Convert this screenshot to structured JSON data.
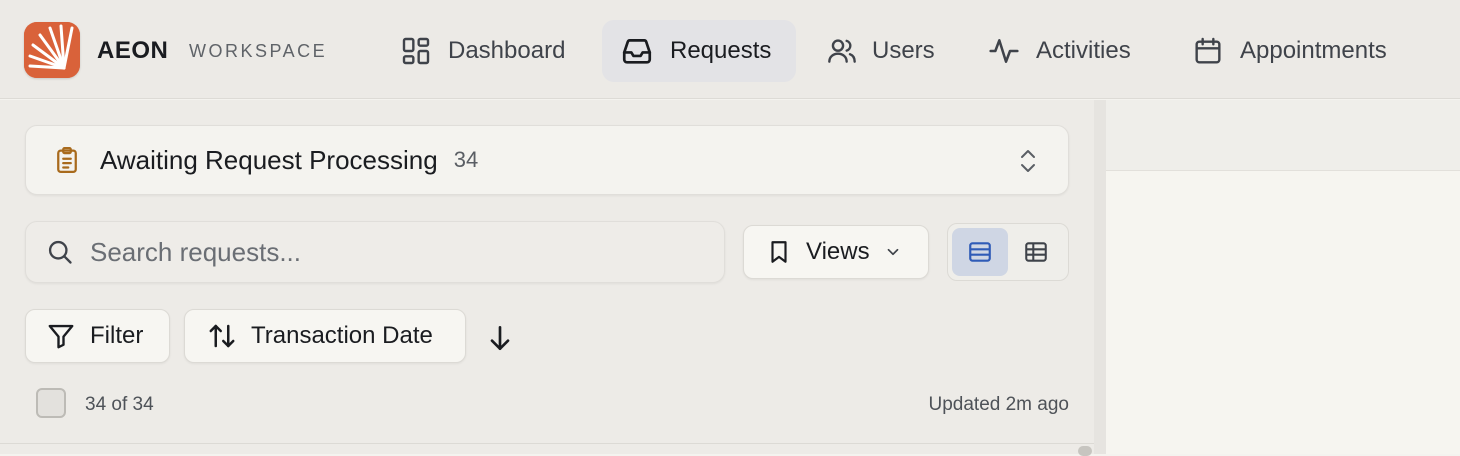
{
  "brand": {
    "name": "AEON",
    "subtitle": "WORKSPACE",
    "logo_icon": "sunburst-logo-icon",
    "logo_color": "#d9623a"
  },
  "nav": {
    "items": [
      {
        "label": "Dashboard",
        "icon": "dashboard-grid-icon",
        "active": false
      },
      {
        "label": "Requests",
        "icon": "inbox-tray-icon",
        "active": true
      },
      {
        "label": "Users",
        "icon": "users-icon",
        "active": false
      },
      {
        "label": "Activities",
        "icon": "activity-pulse-icon",
        "active": false
      },
      {
        "label": "Appointments",
        "icon": "calendar-icon",
        "active": false
      }
    ]
  },
  "queue": {
    "title": "Awaiting Request Processing",
    "count": "34",
    "icon": "clipboard-icon",
    "icon_color": "#a86a1c",
    "selector_icon": "chevrons-up-down-icon"
  },
  "search": {
    "placeholder": "Search requests...",
    "icon": "search-icon"
  },
  "views": {
    "label": "Views",
    "icon": "bookmark-icon",
    "dropdown_icon": "chevron-down-icon"
  },
  "layout_toggle": {
    "active": "list",
    "options": [
      "list",
      "table"
    ],
    "active_color": "#cfd6e4"
  },
  "filter": {
    "label": "Filter",
    "icon": "funnel-icon"
  },
  "sort": {
    "label": "Transaction Date",
    "icon": "sort-arrows-icon",
    "direction_icon": "arrow-down-icon"
  },
  "list_status": {
    "count_text": "34 of 34",
    "updated_text": "Updated 2m ago"
  }
}
